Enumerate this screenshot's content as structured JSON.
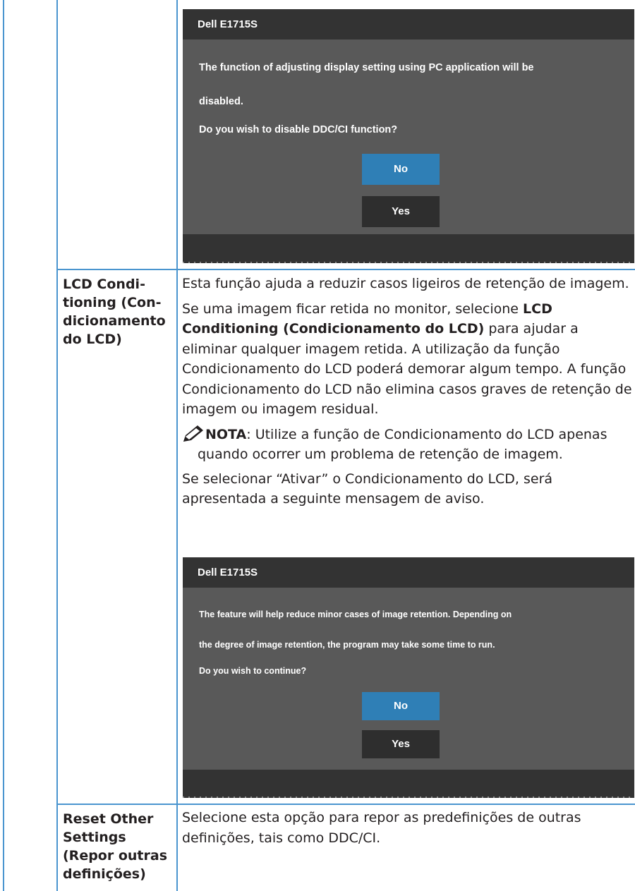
{
  "dialog1": {
    "title": "Dell E1715S",
    "line1": "The function of adjusting display setting using PC application will be",
    "line2": "disabled.",
    "line3": "Do you wish to disable DDC/CI function?",
    "no_label": "No",
    "yes_label": "Yes"
  },
  "lcd_conditioning": {
    "label_lines": [
      "LCD Condi-",
      "tioning (Con-",
      "dicionamento",
      "do LCD)"
    ],
    "para1": "Esta função ajuda a reduzir casos ligeiros de retenção de imagem.",
    "para2_start": "Se uma imagem ficar retida no monitor, selecione ",
    "para2_bold": "LCD Conditioning (Condicionamento do LCD)",
    "para2_end": " para ajudar a eliminar qualquer imagem retida. A utilização da função Condicionamento do LCD poderá demorar algum tempo. A função Condicionamento do LCD não elimina casos graves de retenção de imagem ou imagem residual.",
    "note_label": "NOTA",
    "note_text": ": Utilize a função de Condicionamento do LCD apenas",
    "note_text2": "quando ocorrer um problema de retenção de imagem.",
    "para3": "Se selecionar “Ativar” o Condicionamento do LCD, será apresentada a seguinte mensagem de aviso."
  },
  "dialog2": {
    "title": "Dell E1715S",
    "line1": "The feature will help reduce minor cases of image retention. Depending on",
    "line2": "the degree of image retention, the program may take some time to run.",
    "line3": "Do you wish to continue?",
    "no_label": "No",
    "yes_label": "Yes"
  },
  "reset_other": {
    "label_lines": [
      "Reset Other",
      "Settings",
      "(Repor outras",
      "definições)"
    ],
    "desc": "Selecione esta opção para repor as predefinições de outras definições, tais como DDC/CI."
  },
  "colors": {
    "grid": "#4a95cf",
    "osd_bg": "#595959",
    "osd_header": "#333333",
    "button_selected": "#2f7fb6",
    "button_default": "#2e2e2e"
  }
}
